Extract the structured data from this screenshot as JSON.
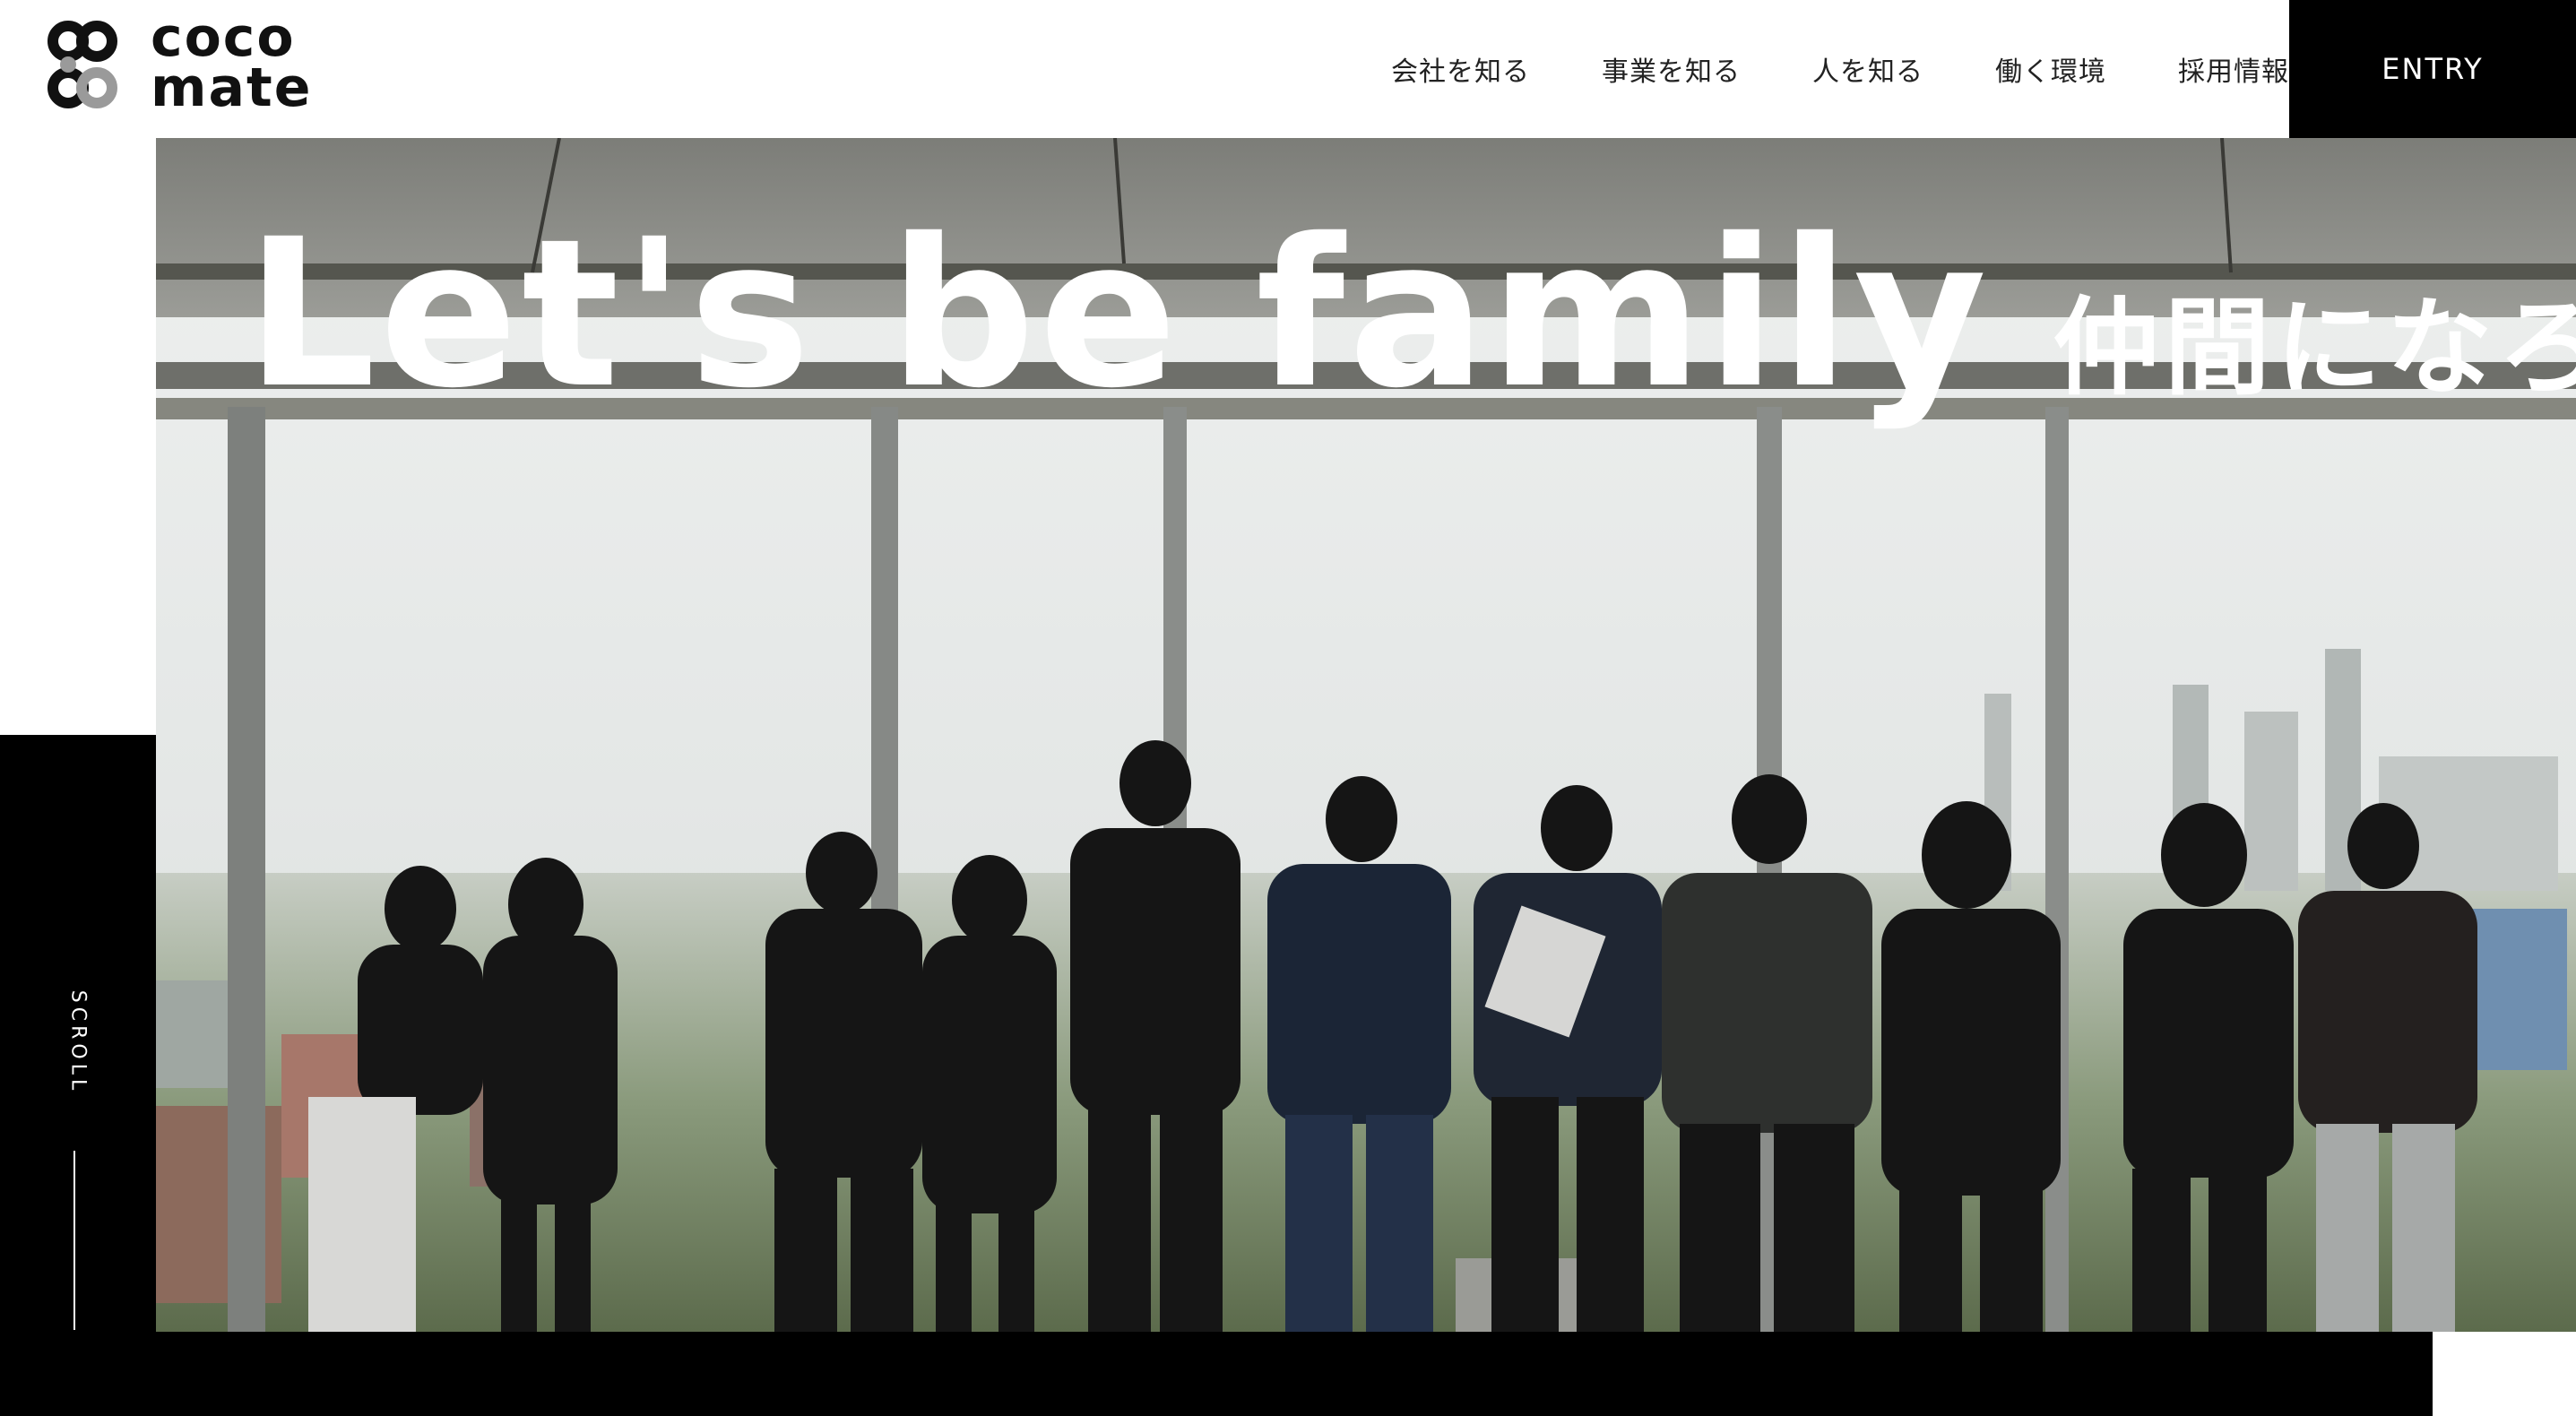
{
  "header": {
    "logo": {
      "line1": "coco",
      "line2": "mate"
    },
    "nav": [
      {
        "label": "会社を知る"
      },
      {
        "label": "事業を知る"
      },
      {
        "label": "人を知る"
      },
      {
        "label": "働く環境"
      },
      {
        "label": "採用情報"
      }
    ],
    "entry_label": "ENTRY"
  },
  "hero": {
    "headline_en": "Let's be family",
    "headline_ja": "仲間になろう"
  },
  "scroll": {
    "label": "SCROLL"
  },
  "colors": {
    "primary": "#000000",
    "background": "#ffffff",
    "headline_text": "#ffffff"
  },
  "icons": {
    "logo_mark": "logo-mark-icon"
  }
}
